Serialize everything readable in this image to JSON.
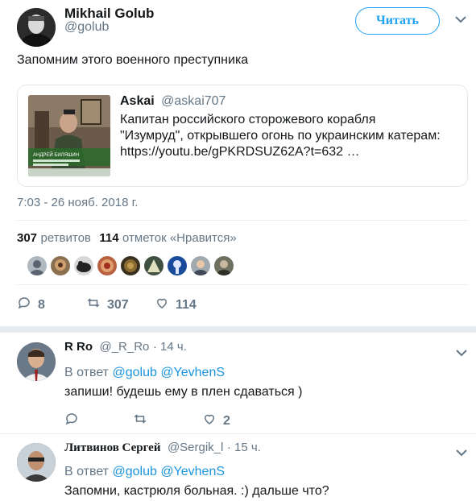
{
  "main_tweet": {
    "author_name": "Mikhail Golub",
    "author_handle": "@golub",
    "follow_label": "Читать",
    "text": "Запомним этого военного преступника",
    "timestamp": "7:03 - 26 нояб. 2018 г.",
    "retweets_count": "307",
    "retweets_label": "ретвитов",
    "likes_count": "114",
    "likes_label": "отметок «Нравится»",
    "actions": {
      "replies": "8",
      "retweets": "307",
      "likes": "114"
    }
  },
  "quoted_tweet": {
    "author_name": "Askai",
    "author_handle": "@askai707",
    "text": "Капитан российского сторожевого корабля \"Изумруд\", открывшего огонь по украинским катерам: https://youtu.be/gPKRDSUZ62A?t=632 …",
    "thumb_caption": "АНДРЕЙ БИЛЯШИН"
  },
  "replies": [
    {
      "author_name": "R Ro",
      "author_handle": "@_R_Ro",
      "time": "· 14 ч.",
      "reply_to_prefix": "В ответ",
      "mention1": "@golub",
      "mention2": "@YevhenS",
      "text": "запиши! будешь ему в плен сдаваться )",
      "likes": "2"
    },
    {
      "author_name": "Литвинов Сергей",
      "author_handle": "@Sergik_l",
      "time": "· 15 ч.",
      "reply_to_prefix": "В ответ",
      "mention1": "@golub",
      "mention2": "@YevhenS",
      "text": "Запомни, кастрюля больная. :) дальше что?"
    }
  ],
  "colors": {
    "accent": "#1da1f2",
    "link": "#1b95e0",
    "muted": "#657786",
    "text": "#14171a",
    "border": "#e1e8ed"
  }
}
